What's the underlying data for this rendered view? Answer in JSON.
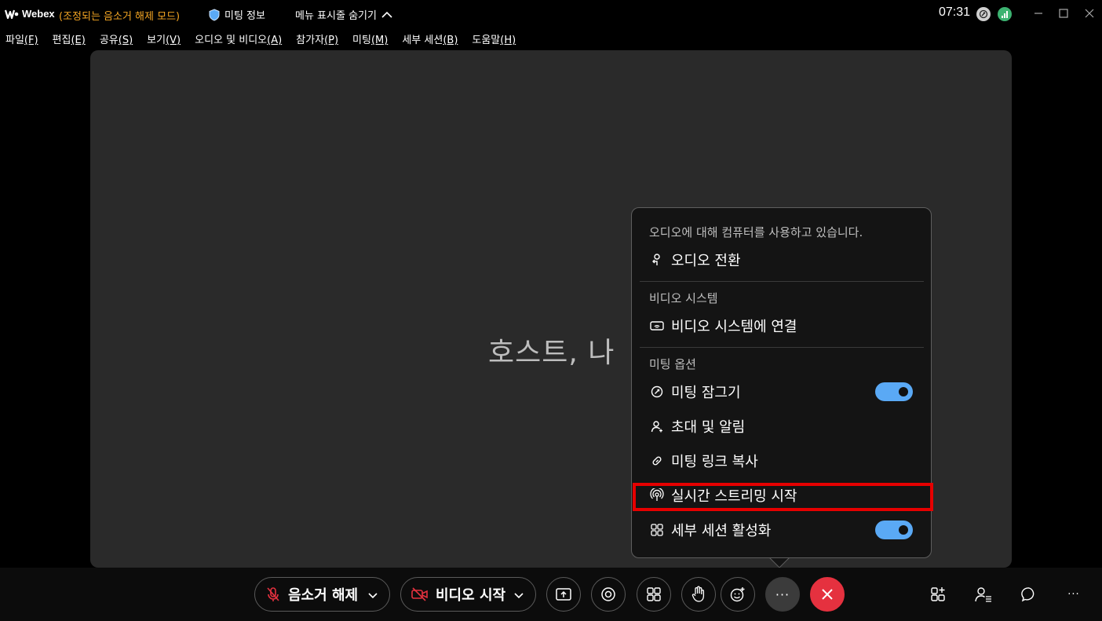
{
  "titlebar": {
    "app_name": "Webex",
    "mode": "(조정되는 음소거 해제 모드)",
    "meeting_info": "미팅 정보",
    "hide_menu": "메뉴 표시줄 숨기기",
    "time": "07:31"
  },
  "menubar": [
    {
      "label": "파일",
      "accel": "(F)"
    },
    {
      "label": "편집",
      "accel": "(E)"
    },
    {
      "label": "공유",
      "accel": "(S)"
    },
    {
      "label": "보기",
      "accel": "(V)"
    },
    {
      "label": "오디오 및 비디오",
      "accel": "(A)"
    },
    {
      "label": "참가자",
      "accel": "(P)"
    },
    {
      "label": "미팅",
      "accel": "(M)"
    },
    {
      "label": "세부 세션",
      "accel": "(B)"
    },
    {
      "label": "도움말",
      "accel": "(H)"
    }
  ],
  "stage": {
    "host_label": "호스트, 나"
  },
  "popup": {
    "audio_section": "오디오에 대해 컴퓨터를 사용하고 있습니다.",
    "switch_audio": "오디오 전환",
    "video_section": "비디오 시스템",
    "connect_video": "비디오 시스템에 연결",
    "options_section": "미팅 옵션",
    "lock_meeting": "미팅 잠그기",
    "lock_meeting_on": true,
    "invite": "초대 및 알림",
    "copy_link": "미팅 링크 복사",
    "livestream": "실시간 스트리밍 시작",
    "breakout": "세부 세션 활성화",
    "breakout_on": true
  },
  "controls": {
    "unmute": "음소거 해제",
    "start_video": "비디오 시작",
    "more": "···"
  },
  "colors": {
    "accent_orange": "#f5a623",
    "toggle_blue": "#5aa9f5",
    "end_red": "#e5313f",
    "highlight_red": "#e60000"
  }
}
